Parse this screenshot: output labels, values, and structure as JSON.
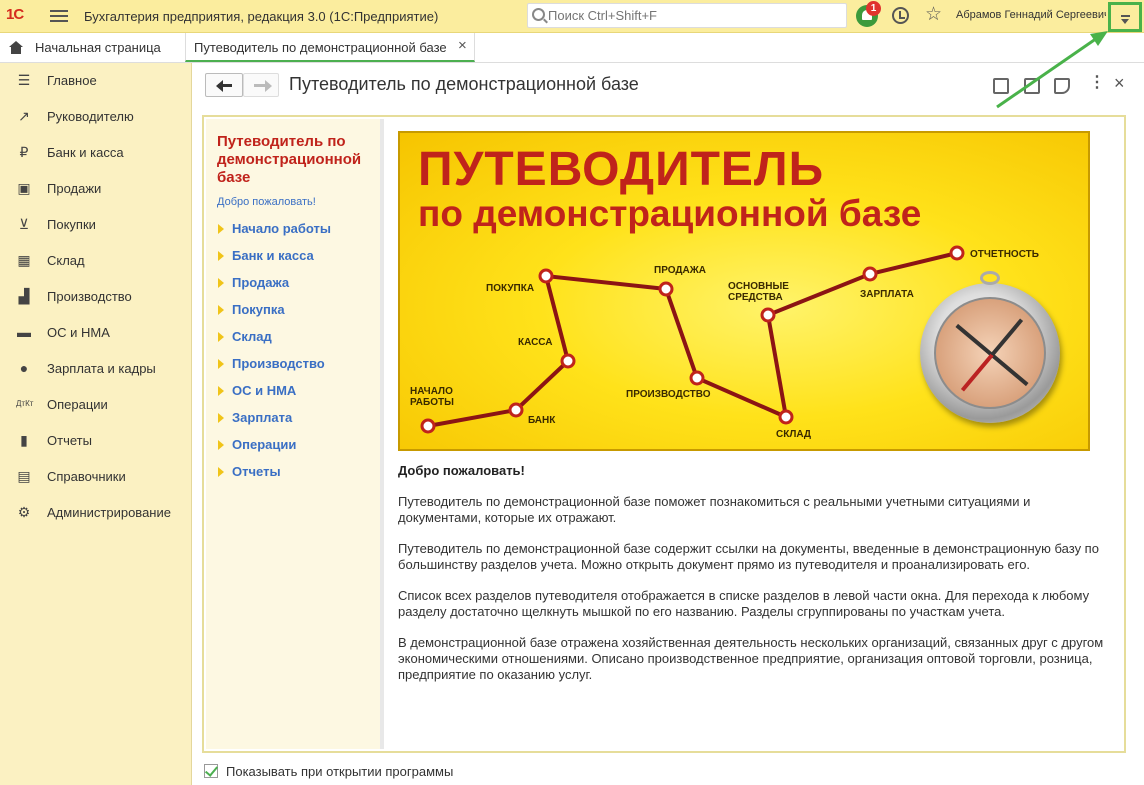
{
  "header": {
    "logo": "1С",
    "app_title": "Бухгалтерия предприятия, редакция 3.0  (1С:Предприятие)",
    "search_placeholder": "Поиск Ctrl+Shift+F",
    "notification_count": "1",
    "user_name": "Абрамов Геннадий Сергеевич",
    "accent_color": "#fbed9e",
    "highlight_color": "#49b24a"
  },
  "tabs": [
    {
      "label": "Начальная страница",
      "icon": "home-icon"
    },
    {
      "label": "Путеводитель по демонстрационной базе",
      "close": "×"
    }
  ],
  "sidebar": {
    "items": [
      {
        "label": "Главное",
        "icon": "list-icon"
      },
      {
        "label": "Руководителю",
        "icon": "trend-icon"
      },
      {
        "label": "Банк и касса",
        "icon": "ruble-icon"
      },
      {
        "label": "Продажи",
        "icon": "bag-icon"
      },
      {
        "label": "Покупки",
        "icon": "cart-icon"
      },
      {
        "label": "Склад",
        "icon": "grid-icon"
      },
      {
        "label": "Производство",
        "icon": "factory-icon"
      },
      {
        "label": "ОС и НМА",
        "icon": "truck-icon"
      },
      {
        "label": "Зарплата и кадры",
        "icon": "person-icon"
      },
      {
        "label": "Операции",
        "icon": "dt-kt-icon"
      },
      {
        "label": "Отчеты",
        "icon": "bar-chart-icon"
      },
      {
        "label": "Справочники",
        "icon": "book-icon"
      },
      {
        "label": "Администрирование",
        "icon": "gear-icon"
      }
    ]
  },
  "form": {
    "title": "Путеводитель по демонстрационной базе",
    "more": "⋮",
    "close": "×"
  },
  "guide": {
    "title": "Путеводитель по демонстрационной базе",
    "welcome_link": "Добро пожаловать!",
    "sections": [
      "Начало работы",
      "Банк и касса",
      "Продажа",
      "Покупка",
      "Склад",
      "Производство",
      "ОС и НМА",
      "Зарплата",
      "Операции",
      "Отчеты"
    ]
  },
  "banner": {
    "title_line1": "ПУТЕВОДИТЕЛЬ",
    "title_line2": "по демонстрационной базе",
    "stops": {
      "start": "Начало работы",
      "bank": "Банк",
      "kassa": "Касса",
      "purchase": "Покупка",
      "sale": "Продажа",
      "production": "Производство",
      "warehouse": "Склад",
      "assets": "Основные средства",
      "salary": "Зарплата",
      "reporting": "Отчетность"
    }
  },
  "content": {
    "welcome_heading": "Добро пожаловать!",
    "paragraphs": [
      "Путеводитель по демонстрационной базе поможет познакомиться с реальными учетными ситуациями и документами, которые их отражают.",
      "Путеводитель по демонстрационной базе содержит ссылки на документы, введенные в демонстрационную базу по большинству разделов учета. Можно открыть документ прямо из путеводителя и проанализировать его.",
      "Список всех разделов путеводителя отображается в списке разделов в левой части окна. Для перехода к любому разделу достаточно щелкнуть мышкой по его названию. Разделы сгруппированы по участкам учета.",
      "В демонстрационной базе отражена хозяйственная деятельность нескольких организаций, связанных друг с другом экономическими отношениями. Описано производственное предприятие, организация оптовой торговли, розница, предприятие по оказанию услуг."
    ]
  },
  "footer": {
    "show_on_startup_label": "Показывать при открытии программы",
    "show_on_startup_checked": true
  }
}
